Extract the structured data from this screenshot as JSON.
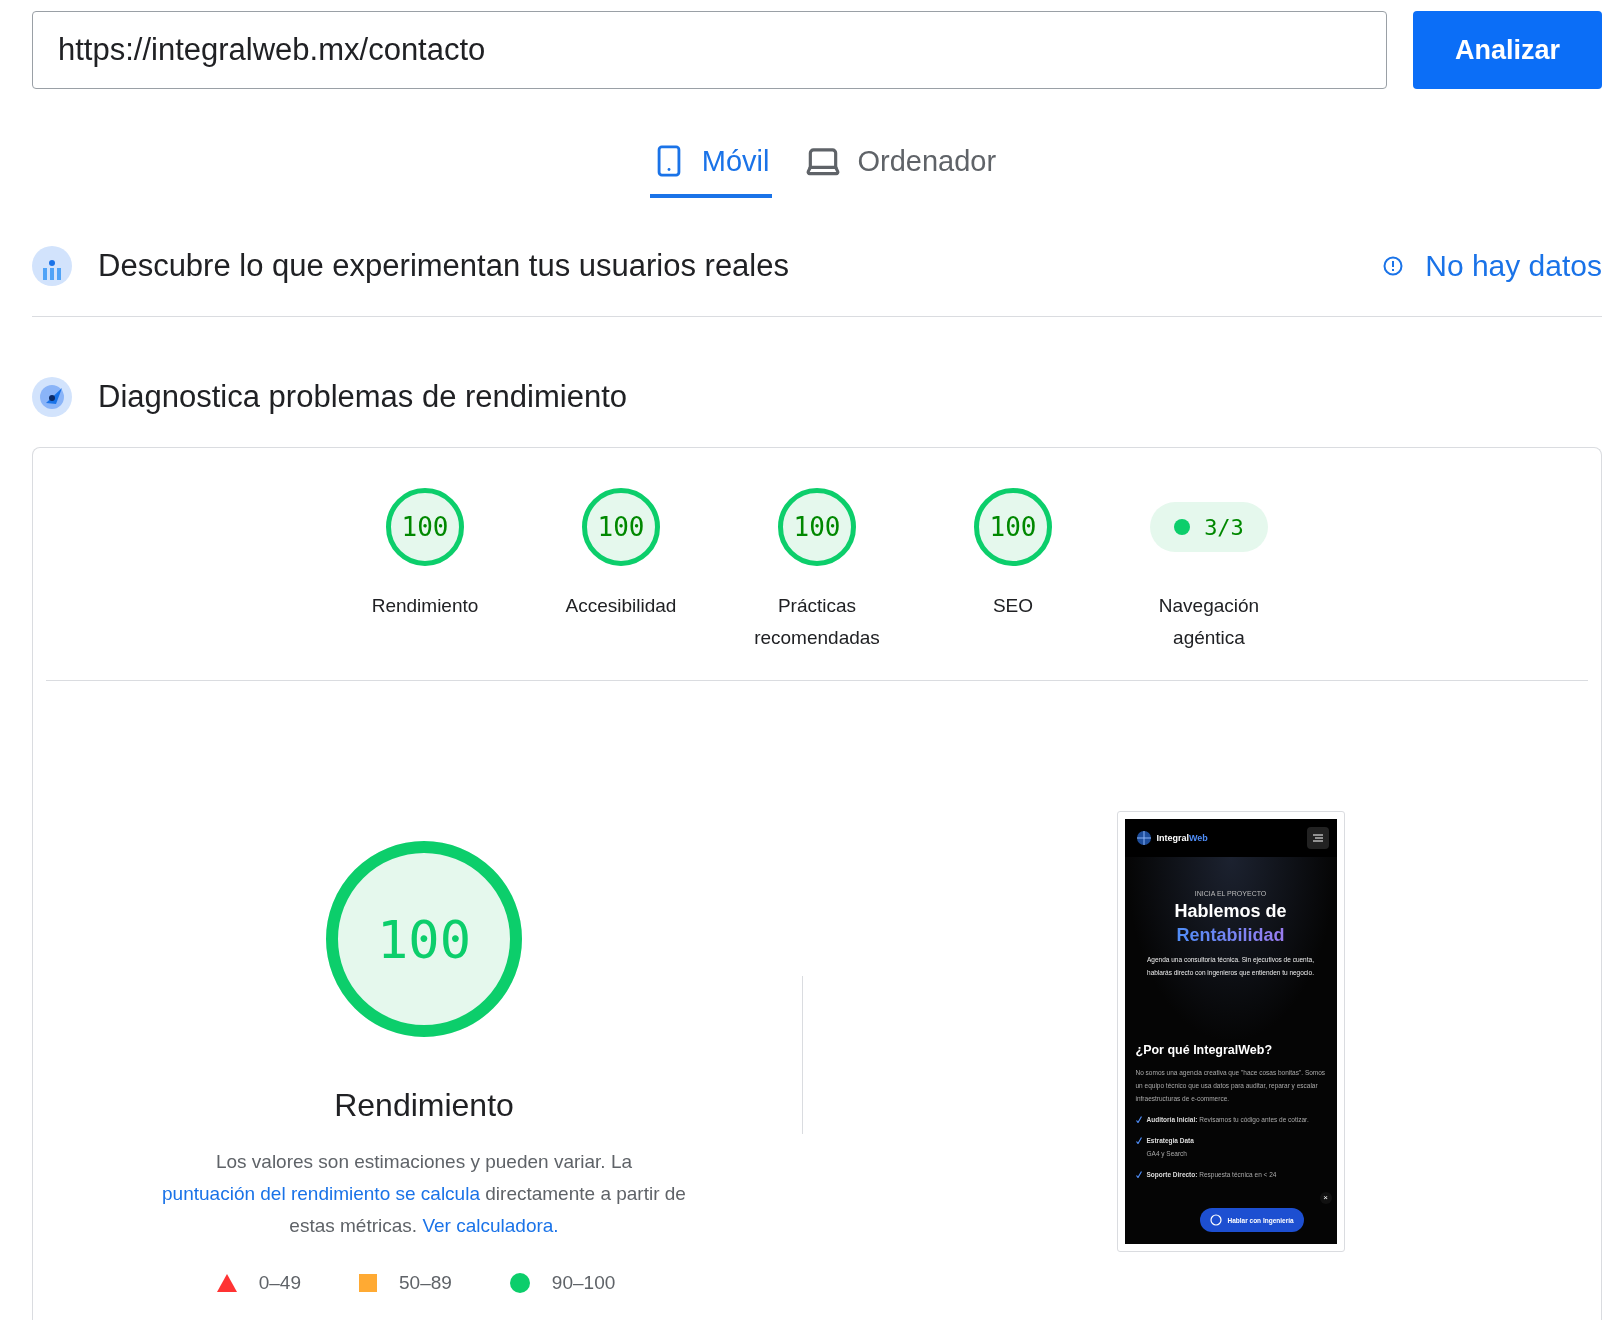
{
  "url_field": {
    "value": "https://integralweb.mx/contacto"
  },
  "analyze_button": "Analizar",
  "device_tabs": [
    {
      "label": "Móvil",
      "kind": "mobile",
      "selected": true
    },
    {
      "label": "Ordenador",
      "kind": "desktop",
      "selected": false
    }
  ],
  "field_data": {
    "title": "Descubre lo que experimentan tus usuarios reales",
    "status": "No hay datos"
  },
  "lab": {
    "title": "Diagnostica problemas de rendimiento",
    "categories": [
      {
        "kind": "gauge",
        "score": "100",
        "level": 1,
        "label": "Rendimiento"
      },
      {
        "kind": "gauge",
        "score": "100",
        "level": 1,
        "label": "Accesibilidad"
      },
      {
        "kind": "gauge",
        "score": "100",
        "level": 1,
        "label": "Prácticas recomendadas"
      },
      {
        "kind": "gauge",
        "score": "100",
        "level": 1,
        "label": "SEO"
      },
      {
        "kind": "pill",
        "score": "3/3",
        "label": "Navegación agéntica"
      }
    ],
    "main": {
      "score": "100",
      "level": 1,
      "title": "Rendimiento",
      "description": [
        {
          "kind": "text",
          "text": "Los valores son estimaciones y pueden variar. La "
        },
        {
          "kind": "link",
          "text": "puntuación del rendimiento se calcula"
        },
        {
          "kind": "text",
          "text": " directamente a partir de estas métricas. "
        },
        {
          "kind": "link",
          "text": "Ver calculadora."
        }
      ]
    },
    "legend": [
      {
        "kind": "triangle",
        "label": "0–49",
        "color": "#ff3333"
      },
      {
        "kind": "square",
        "label": "50–89",
        "color": "#ffaa33"
      },
      {
        "kind": "circle",
        "label": "90–100",
        "color": "#0cce6b"
      }
    ]
  },
  "screenshot": {
    "brand": [
      "Integral",
      "Web"
    ],
    "eyebrow": "INICIA EL PROYECTO",
    "heading": [
      "Hablemos de",
      "Rentabilidad"
    ],
    "intro": "Agenda una consultoría técnica. Sin ejecutivos de cuenta, hablarás directo con ingenieros que entienden tu negocio.",
    "section_title": "¿Por qué IntegralWeb?",
    "section_text": "No somos una agencia creativa que \"hace cosas bonitas\". Somos un equipo técnico que usa datos para auditar, reparar y escalar infraestructuras de e-commerce.",
    "features": [
      {
        "title": "Auditoría Inicial:",
        "text": "Revisamos tu código antes de cotizar."
      },
      {
        "title": "Estrategia Data",
        "text": "GA4 y Search"
      },
      {
        "title": "Soporte Directo:",
        "text": "Respuesta técnica en < 24"
      }
    ],
    "chat_button": "Hablar con Ingeniería",
    "close": "×"
  }
}
